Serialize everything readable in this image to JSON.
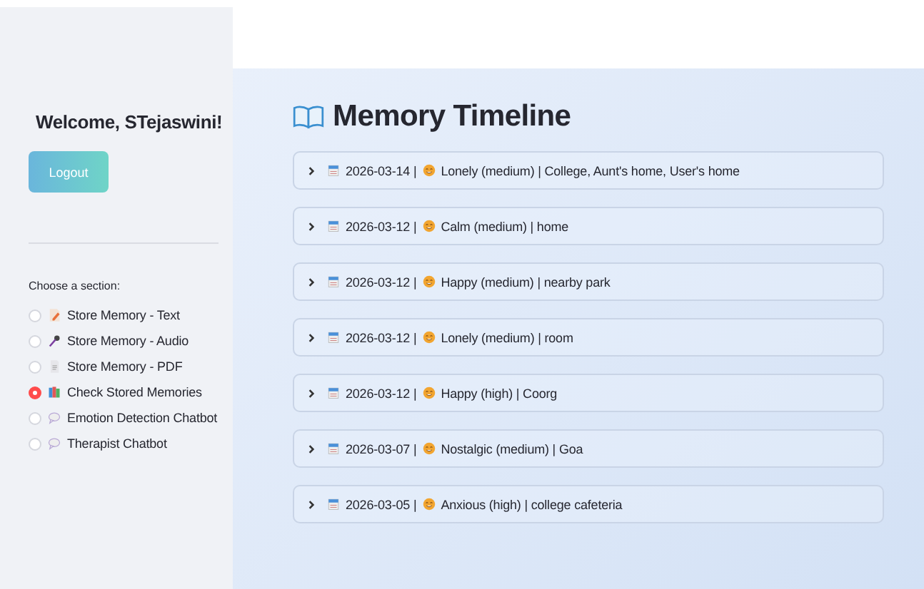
{
  "sidebar": {
    "welcome": "Welcome, STejaswini!",
    "logout_button": "Logout",
    "section_label": "Choose a section:",
    "options": [
      {
        "label": "Store Memory - Text",
        "kind": "text",
        "selected": false
      },
      {
        "label": "Store Memory - Audio",
        "kind": "audio",
        "selected": false
      },
      {
        "label": "Store Memory - PDF",
        "kind": "pdf",
        "selected": false
      },
      {
        "label": "Check Stored Memories",
        "kind": "memories",
        "selected": true
      },
      {
        "label": "Emotion Detection Chatbot",
        "kind": "chat",
        "selected": false
      },
      {
        "label": "Therapist Chatbot",
        "kind": "chat",
        "selected": false
      }
    ]
  },
  "main": {
    "title": "Memory Timeline",
    "entries": [
      {
        "date": "2026-03-14 |",
        "summary": "Lonely (medium) | College, Aunt's home, User's home",
        "expanded": false
      },
      {
        "date": "2026-03-12 |",
        "summary": "Calm (medium) | home",
        "expanded": false
      },
      {
        "date": "2026-03-12 |",
        "summary": "Happy (medium) | nearby park",
        "expanded": false
      },
      {
        "date": "2026-03-12 |",
        "summary": "Lonely (medium) | room",
        "expanded": false
      },
      {
        "date": "2026-03-12 |",
        "summary": "Happy (high) | Coorg",
        "expanded": false
      },
      {
        "date": "2026-03-07 |",
        "summary": "Nostalgic (medium) | Goa",
        "expanded": false
      },
      {
        "date": "2026-03-05 |",
        "summary": "Anxious (high) | college cafeteria",
        "expanded": false
      }
    ]
  }
}
